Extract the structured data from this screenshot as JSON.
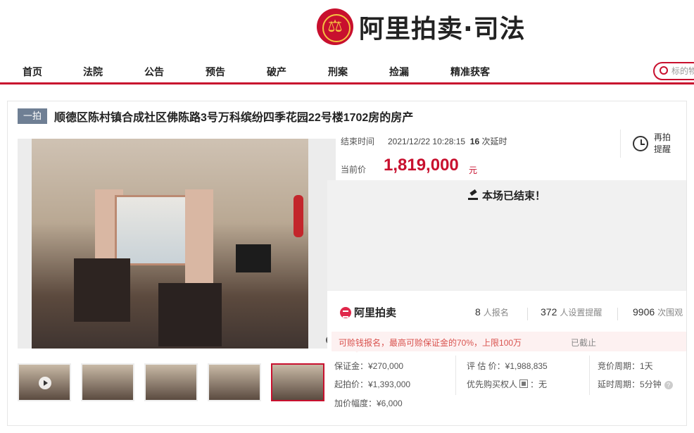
{
  "header": {
    "logo_text": "阿里拍卖·司法",
    "emblem_icon": "court-emblem-icon"
  },
  "nav": {
    "items": [
      "首页",
      "法院",
      "公告",
      "预告",
      "破产",
      "刑案",
      "捡漏",
      "精准获客"
    ],
    "search_placeholder": "标的物",
    "accent_color": "#c8102e"
  },
  "item": {
    "badge": "一拍",
    "title": "顺德区陈村镇合成社区佛陈路3号万科缤纷四季花园22号楼1702房的房产"
  },
  "auction": {
    "end_time_label": "结束时间",
    "end_time": "2021/12/22 10:28:15",
    "delay_count": "16",
    "delay_suffix": "次延时",
    "current_price_label": "当前价",
    "current_price": "1,819,000",
    "price_unit": "元",
    "remind_label": "再拍提醒",
    "ended_text": "本场已结束！",
    "price_color": "#c8102e"
  },
  "stats": {
    "brand": "阿里拍卖",
    "registrants": "8",
    "registrants_label": "人报名",
    "reminders": "372",
    "reminders_label": "人设置提醒",
    "views": "9906",
    "views_label": "次围观"
  },
  "notice": {
    "text": "可赊钱报名，最高可赊保证金的70%，上限100万",
    "status": "已截止"
  },
  "details": {
    "deposit": "保证金：¥270,000",
    "start_price": "起拍价：¥1,393,000",
    "increment": "加价幅度：¥6,000",
    "appraisal": "评 估 价：¥1,988,835",
    "priority_buyer_label": "优先购买权人",
    "priority_buyer_value": "：无",
    "bid_cycle": "竞价周期：1天",
    "delay_cycle": "延时周期：5分钟"
  },
  "gallery": {
    "thumbnail_count": 5,
    "active_index": 4
  }
}
